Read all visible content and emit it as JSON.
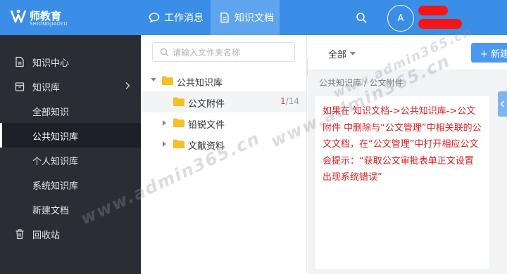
{
  "header": {
    "logo_title": "师教育",
    "logo_subtitle": "SHIONGJIAOYU",
    "tabs": [
      {
        "label": "工作消息",
        "icon": "chat-bubble-icon"
      },
      {
        "label": "知识文档",
        "icon": "document-icon"
      }
    ],
    "avatar_initial": "A",
    "brand_color": "#3a8ee6"
  },
  "sidebar": {
    "items": [
      {
        "label": "知识中心",
        "icon": "document-icon"
      },
      {
        "label": "知识库",
        "icon": "archive-box-icon"
      },
      {
        "label": "全部知识"
      },
      {
        "label": "公共知识库"
      },
      {
        "label": "个人知识库"
      },
      {
        "label": "系统知识库"
      },
      {
        "label": "新建文档"
      },
      {
        "label": "回收站",
        "icon": "trash-icon"
      }
    ]
  },
  "tree": {
    "search_placeholder": "请输入文件夹名称",
    "nodes": [
      {
        "label": "公共知识库",
        "expanded": true
      },
      {
        "label": "公文附件",
        "count_current": "1",
        "count_total": "/14",
        "selected": true
      },
      {
        "label": "铅锐文件",
        "expanded": false
      },
      {
        "label": "文献资料",
        "expanded": false
      }
    ]
  },
  "main": {
    "filter_label": "全部",
    "new_button_label": "+ 新建",
    "breadcrumb": "公共知识库 / 公文附件",
    "note": "如果在 知识文档->公共知识库->公文附件 中删除与“公文管理”中相关联的公文文档，在“公文管理”中打开相应公文会提示：“获取公文审批表单正文设置出现系统错误”"
  },
  "watermark": "www.admin365.cn"
}
